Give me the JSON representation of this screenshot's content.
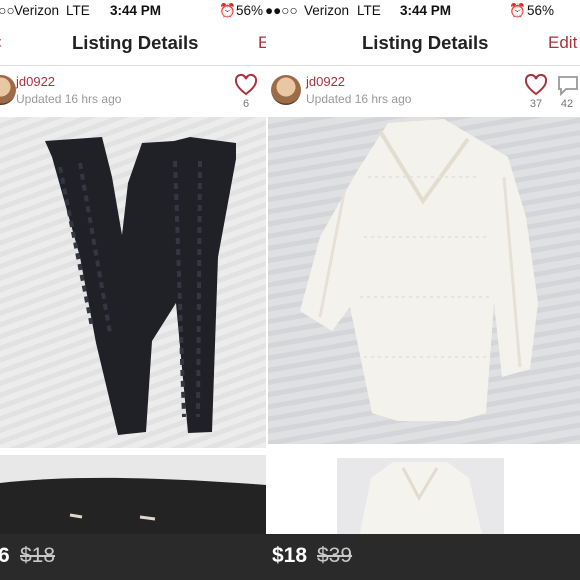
{
  "colors": {
    "accent": "#a8333f",
    "bar": "#2a2a2a"
  },
  "left": {
    "status": {
      "carrier": "Verizon",
      "network": "LTE",
      "time": "3:44 PM",
      "battery": "56%"
    },
    "nav": {
      "title": "Listing Details",
      "action_label": "E",
      "back_icon": "arrow-left-icon"
    },
    "seller": {
      "username": "jd0922",
      "updated": "Updated 16 hrs ago"
    },
    "likes": "6",
    "price": "6",
    "original_price": "$18"
  },
  "right": {
    "status": {
      "carrier": "Verizon",
      "network": "LTE",
      "time": "3:44 PM",
      "battery": "56%"
    },
    "nav": {
      "title": "Listing Details",
      "action_label": "Edit"
    },
    "seller": {
      "username": "jd0922",
      "updated": "Updated 16 hrs ago"
    },
    "likes": "37",
    "comments": "42",
    "price": "$18",
    "original_price": "$39"
  }
}
